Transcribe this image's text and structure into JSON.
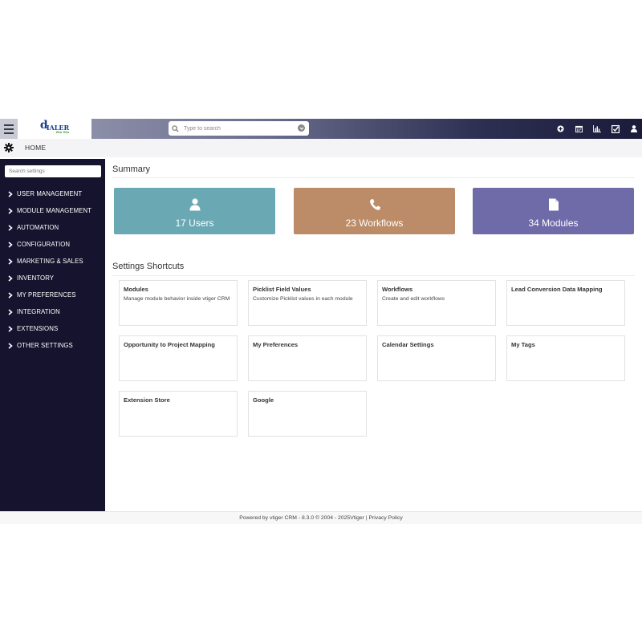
{
  "header": {
    "logo_text": "IALER",
    "logo_sub": "Win Win",
    "search_placeholder": "Type to search",
    "icons": [
      "plus-circle-icon",
      "calendar-icon",
      "chart-icon",
      "tasks-icon",
      "user-icon"
    ]
  },
  "breadcrumb": {
    "home": "HOME"
  },
  "sidebar": {
    "search_placeholder": "Search settings",
    "items": [
      {
        "label": "USER MANAGEMENT"
      },
      {
        "label": "MODULE MANAGEMENT"
      },
      {
        "label": "AUTOMATION"
      },
      {
        "label": "CONFIGURATION"
      },
      {
        "label": "MARKETING & SALES"
      },
      {
        "label": "INVENTORY"
      },
      {
        "label": "MY PREFERENCES"
      },
      {
        "label": "INTEGRATION"
      },
      {
        "label": "EXTENSIONS"
      },
      {
        "label": "OTHER SETTINGS"
      }
    ]
  },
  "summary": {
    "title": "Summary",
    "cards": [
      {
        "label": "17 Users",
        "icon": "user-icon",
        "color": "#6aa9b3"
      },
      {
        "label": "23  Workflows",
        "icon": "phone-icon",
        "color": "#bb8c67"
      },
      {
        "label": "34 Modules",
        "icon": "file-icon",
        "color": "#6f6aa8"
      }
    ]
  },
  "shortcuts": {
    "title": "Settings Shortcuts",
    "items": [
      {
        "title": "Modules",
        "desc": "Manage module behavior inside vtiger CRM"
      },
      {
        "title": "Picklist Field Values",
        "desc": "Customize Picklist values in each module"
      },
      {
        "title": "Workflows",
        "desc": "Create and edit workflows"
      },
      {
        "title": "Lead Conversion Data Mapping",
        "desc": ""
      },
      {
        "title": "Opportunity to Project Mapping",
        "desc": ""
      },
      {
        "title": "My Preferences",
        "desc": ""
      },
      {
        "title": "Calendar Settings",
        "desc": ""
      },
      {
        "title": "My Tags",
        "desc": ""
      },
      {
        "title": "Extension Store",
        "desc": ""
      },
      {
        "title": "Google",
        "desc": ""
      }
    ]
  },
  "footer": {
    "powered": "Powered by vtiger CRM - 8.3.0  © 2004 - 2025 ",
    "vtiger_link": "Vtiger",
    "sep": " | ",
    "privacy_link": "Privacy Policy"
  }
}
